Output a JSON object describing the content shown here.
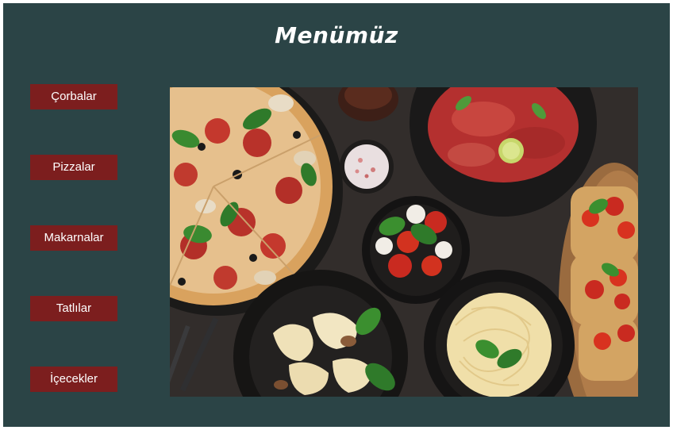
{
  "page": {
    "title": "Menümüz"
  },
  "nav": {
    "items": [
      {
        "label": "Çorbalar"
      },
      {
        "label": "Pizzalar"
      },
      {
        "label": "Makarnalar"
      },
      {
        "label": "Tatlılar"
      },
      {
        "label": "İçecekler"
      }
    ]
  },
  "colors": {
    "background": "#2b4446",
    "button": "#7c1e1e",
    "title_text": "#ffffff"
  },
  "hero_image": {
    "subject": "food-spread"
  }
}
